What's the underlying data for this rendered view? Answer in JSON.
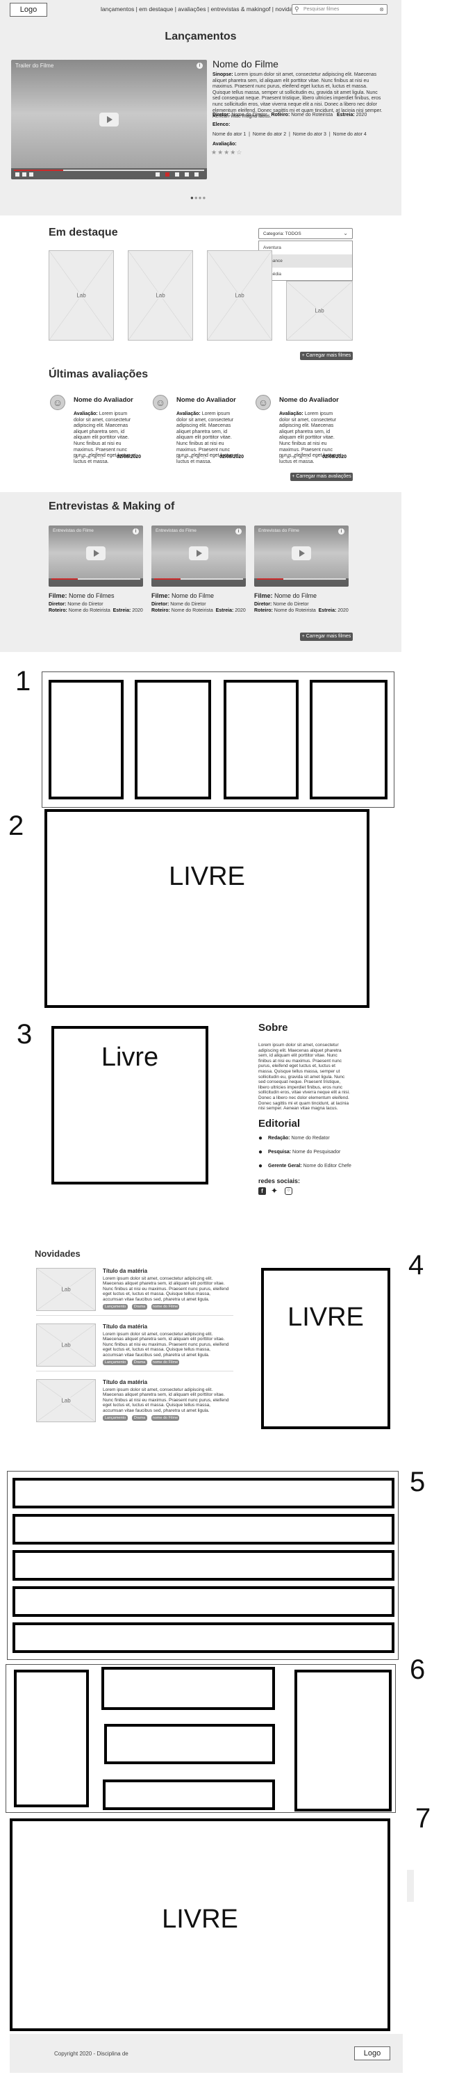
{
  "header": {
    "logo": "Logo",
    "nav": [
      "lançamentos",
      "em destaque",
      "avaliações",
      "entrevistas & makingof",
      "novidades"
    ],
    "nav_separator": "|",
    "search_placeholder": "Pesquisar filmes"
  },
  "launches": {
    "title": "Lançamentos",
    "video_title": "Trailer do Filme",
    "movie_name": "Nome do Filme",
    "synopsis_label": "Sinopse:",
    "synopsis": "Lorem ipsum dolor sit amet, consectetur adipiscing elit. Maecenas aliquet pharetra sem, id aliquam elit porttitor vitae. Nunc finibus at nisi eu maximus. Praesent nunc purus, eleifend eget luctus et, luctus et massa. Quisque tellus massa, semper ut sollicitudin eu, gravida sit amet ligula. Nunc sed consequat neque. Praesent tristique, libero ultricies imperdiet finibus, eros nunc sollicitudin eros, vitae viverra neque elit a nisi. Donec a libero nec dolor elementum eleifend. Donec sagittis mi et quam tincidunt, at lacinia nisi semper. Aenean vitae magna lacus.",
    "director_label": "Diretor:",
    "director": "Nome do Diretor",
    "writer_label": "Roteiro:",
    "writer": "Nome do Roteirista",
    "release_label": "Estreia:",
    "release": "2020",
    "cast_label": "Elenco:",
    "cast": "Nome do ator 1  |  Nome do ator 2  |  Nome do ator 3  |  Nome do ator 4",
    "rating_label": "Avaliação:",
    "stars": "★★★★☆"
  },
  "featured": {
    "title": "Em destaque",
    "select_value": "Categoria: TODOS",
    "options": [
      "Aventura",
      "Romance",
      "Comédia"
    ],
    "thumb_label": "Lab",
    "load_more": "Carregar mais filmes"
  },
  "reviews": {
    "title": "Últimas avaliações",
    "items": [
      {
        "name": "Nome do Avaliador",
        "label": "Avaliação:",
        "text": "Lorem ipsum dolor sit amet, consectetur adipiscing elit. Maecenas aliquet pharetra sem, id aliquam elit porttitor vitae. Nunc finibus at nisi eu maximus. Praesent nunc purus, eleifend eget luctus et, luctus et massa.",
        "stars": "★★★★☆",
        "date": "02/08/2020"
      },
      {
        "name": "Nome do Avaliador",
        "label": "Avaliação:",
        "text": "Lorem ipsum dolor sit amet, consectetur adipiscing elit. Maecenas aliquet pharetra sem, id aliquam elit porttitor vitae. Nunc finibus at nisi eu maximus. Praesent nunc purus, eleifend eget luctus et, luctus et massa.",
        "stars": "★★★★☆",
        "date": "02/08/2020"
      },
      {
        "name": "Nome do Avaliador",
        "label": "Avaliação:",
        "text": "Lorem ipsum dolor sit amet, consectetur adipiscing elit. Maecenas aliquet pharetra sem, id aliquam elit porttitor vitae. Nunc finibus at nisi eu maximus. Praesent nunc purus, eleifend eget luctus et, luctus et massa.",
        "stars": "★★★★☆",
        "date": "02/08/2020"
      }
    ],
    "load_more": "Carregar mais avaliações"
  },
  "interviews": {
    "title": "Entrevistas & Making of",
    "items": [
      {
        "video_title": "Entrevistas do Filme",
        "film_label": "Filme:",
        "film": "Nome do Filmes",
        "director_label": "Diretor:",
        "director": "Nome do Diretor",
        "writer_label": "Roteiro:",
        "writer": "Nome do Roteirista",
        "release_label": "Estreia:",
        "release": "2020"
      },
      {
        "video_title": "Entrevistas do Filme",
        "film_label": "Filme:",
        "film": "Nome do Filme",
        "director_label": "Diretor:",
        "director": "Nome do Diretor",
        "writer_label": "Roteiro:",
        "writer": "Nome do Roteirista",
        "release_label": "Estreia:",
        "release": "2020"
      },
      {
        "video_title": "Entrevistas do Filme",
        "film_label": "Filme:",
        "film": "Nome do Filme",
        "director_label": "Diretor:",
        "director": "Nome do Diretor",
        "writer_label": "Roteiro:",
        "writer": "Nome do Roteirista",
        "release_label": "Estreia:",
        "release": "2020"
      }
    ],
    "load_more": "Carregar mais filmes"
  },
  "sketches": {
    "n1": "1",
    "n2": "2",
    "n3": "3",
    "n4": "4",
    "n5": "5",
    "n6": "6",
    "n7": "7",
    "livre2": "LIVRE",
    "livre3": "Livre",
    "livre4": "LIVRE",
    "livre7": "LIVRE"
  },
  "about": {
    "title": "Sobre",
    "text": "Lorem ipsum dolor sit amet, consectetur adipiscing elit. Maecenas aliquet pharetra sem, id aliquam elit porttitor vitae. Nunc finibus at nisi eu maximus. Praesent nunc purus, eleifend eget luctus et, luctus et massa. Quisque tellus massa, semper ut sollicitudin eu, gravida sit amet ligula. Nunc sed consequat neque. Praesent tristique, libero ultricies imperdiet finibus, eros nunc sollicitudin eros, vitae viverra neque elit a nisi. Donec a libero nec dolor elementum eleifend. Donec sagittis mi et quam tincidunt, at lacinia nisi semper. Aenean vitae magna lacus.",
    "editorial_title": "Editorial",
    "editorial": [
      {
        "label": "Redação:",
        "value": "Nome do Redator"
      },
      {
        "label": "Pesquisa:",
        "value": "Nome do Pesquisador"
      },
      {
        "label": "Gerente Geral:",
        "value": "Nome do Editor Chefe"
      }
    ],
    "social_title": "redes sociais:"
  },
  "news": {
    "title": "Novidades",
    "thumb_label": "Lab",
    "items": [
      {
        "title": "Título da matéria",
        "text": "Lorem ipsum dolor sit amet, consectetur adipiscing elit. Maecenas aliquet pharetra sem, id aliquam elit porttitor vitae. Nunc finibus at nisi eu maximus. Praesent nunc purus, eleifend eget luctus et, luctus et massa. Quisque tellus massa, accumsan vitae faucibus sed, pharetra ut amet ligula.",
        "tags": [
          "Lançamento",
          "Drama",
          "nome do Filme"
        ]
      },
      {
        "title": "Título da matéria",
        "text": "Lorem ipsum dolor sit amet, consectetur adipiscing elit. Maecenas aliquet pharetra sem, id aliquam elit porttitor vitae. Nunc finibus at nisi eu maximus. Praesent nunc purus, eleifend eget luctus et, luctus et massa. Quisque tellus massa, accumsan vitae faucibus sed, pharetra ut amet ligula.",
        "tags": [
          "Lançamento",
          "Drama",
          "nome do Filme"
        ]
      },
      {
        "title": "Título da matéria",
        "text": "Lorem ipsum dolor sit amet, consectetur adipiscing elit. Maecenas aliquet pharetra sem, id aliquam elit porttitor vitae. Nunc finibus at nisi eu maximus. Praesent nunc purus, eleifend eget luctus et, luctus et massa. Quisque tellus massa, accumsan vitae faucibus sed, pharetra ut amet ligula.",
        "tags": [
          "Lançamento",
          "Drama",
          "nome do Filme"
        ]
      }
    ]
  },
  "footer": {
    "copyright": "Copyright 2020 - Disciplina de",
    "logo": "Logo"
  },
  "colors": {
    "panel": "#eeeeee",
    "progress": "#cc2a2a",
    "dark_button": "#555555"
  }
}
